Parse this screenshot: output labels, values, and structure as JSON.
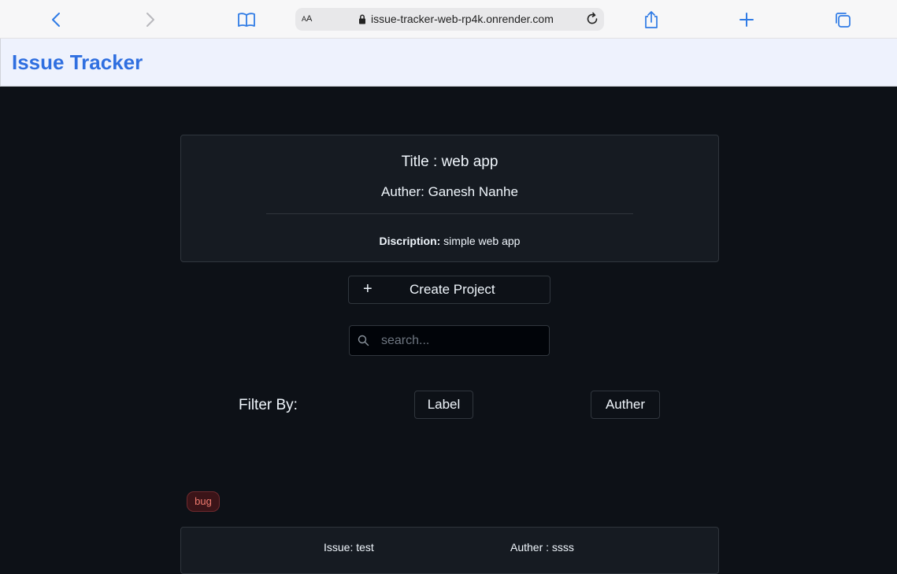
{
  "browser": {
    "text_size_label_big": "A",
    "text_size_label_small": "A",
    "url": "issue-tracker-web-rp4k.onrender.com",
    "icons": [
      "back-icon",
      "forward-icon",
      "bookmarks-icon",
      "lock-icon",
      "reload-icon",
      "share-icon",
      "new-tab-icon",
      "tabs-icon"
    ]
  },
  "header": {
    "title": "Issue Tracker",
    "title_color": "#2f6fe0"
  },
  "project": {
    "title": "Title : web app",
    "author": "Auther: Ganesh Nanhe",
    "description_label": "Discription:",
    "description_value": " simple web app"
  },
  "actions": {
    "create_icon": "+",
    "create_label": "Create Project"
  },
  "search": {
    "placeholder": "search...",
    "value": ""
  },
  "filter": {
    "label": "Filter By:",
    "options": [
      "Label",
      "Auther"
    ]
  },
  "issues": [
    {
      "label": "bug",
      "label_color": "#f07a6e",
      "name": "Issue: test",
      "author": "Auther : ssss"
    }
  ]
}
